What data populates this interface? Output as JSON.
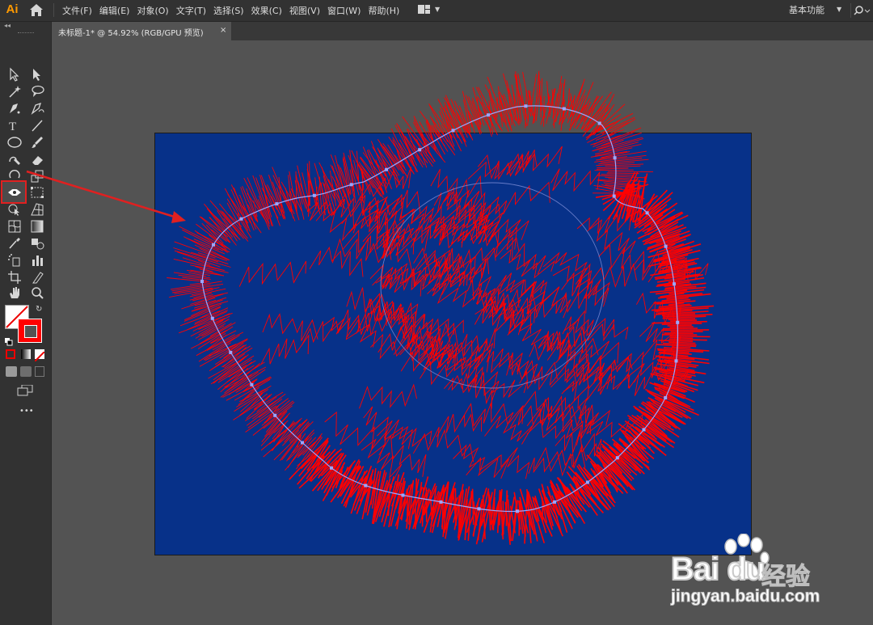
{
  "app": {
    "logo": "Ai",
    "menu": [
      "文件(F)",
      "编辑(E)",
      "对象(O)",
      "文字(T)",
      "选择(S)",
      "效果(C)",
      "视图(V)",
      "窗口(W)",
      "帮助(H)"
    ],
    "workspace": "基本功能",
    "home_icon": "home-icon",
    "layout_icon": "arrange-documents-icon",
    "search_icon": "search-icon"
  },
  "toolbar": {
    "selected_tool": "puppet-warp-tool",
    "more_label": "•••"
  },
  "document": {
    "tab_title": "未标题-1* @ 54.92% (RGB/GPU 预览)",
    "close_label": "×"
  },
  "colors": {
    "artboard": "#073189",
    "shape_fill": "#ff0000",
    "path_line": "#9aa6ff",
    "fill_swatch": "#ff0000",
    "annotation": "#e02020"
  },
  "watermark": {
    "brand": "Bai  du",
    "cn": "经验",
    "url": "jingyan.baidu.com"
  }
}
